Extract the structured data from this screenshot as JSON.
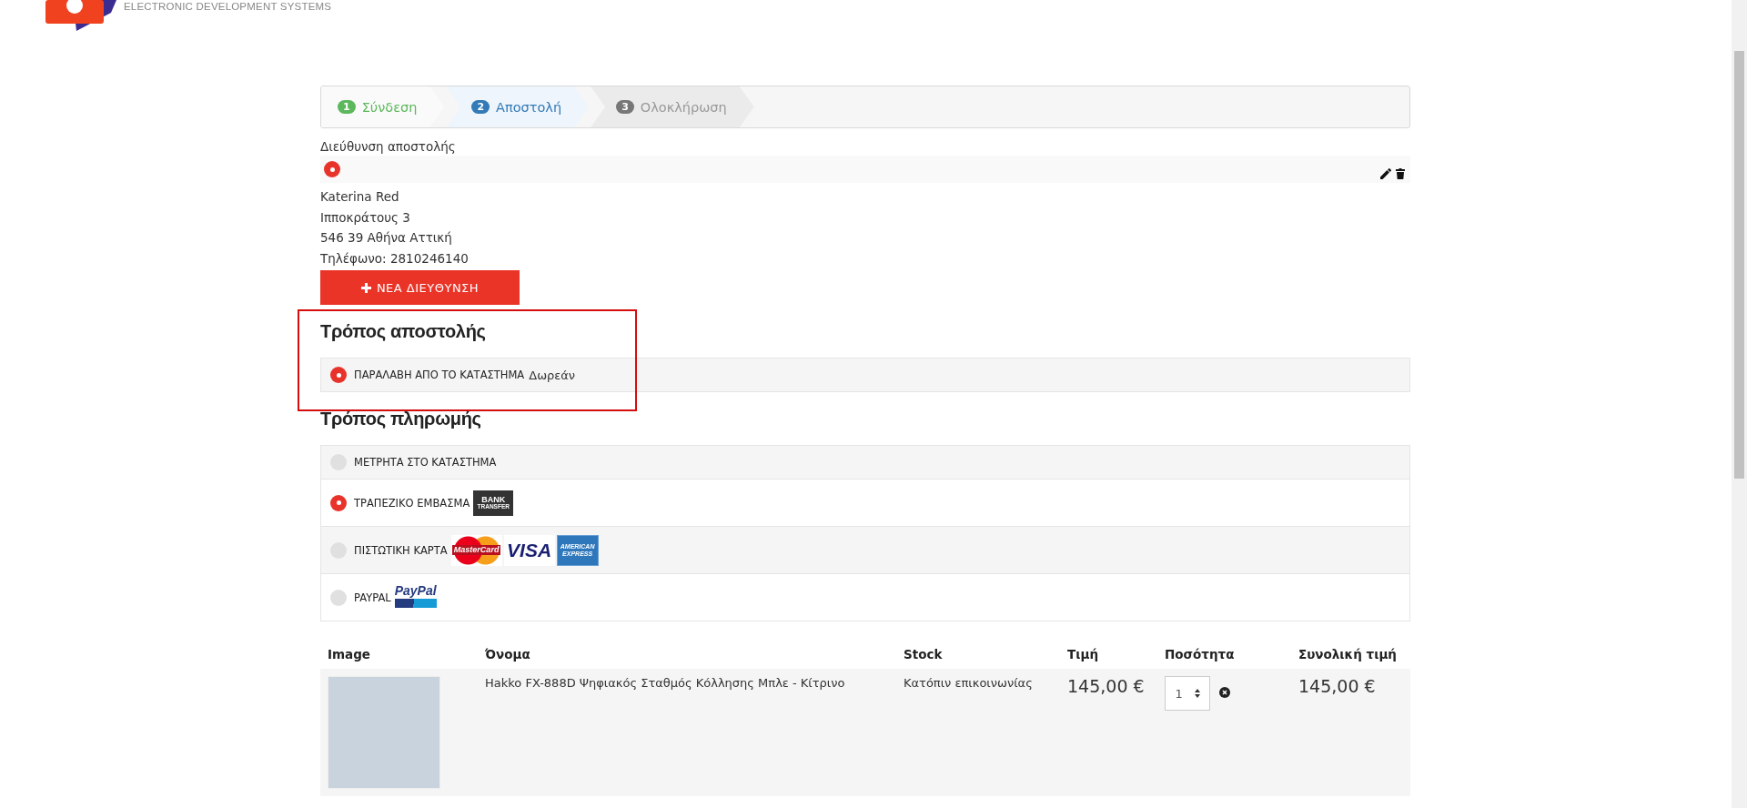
{
  "logo": {
    "tagline": "ELECTRONIC DEVELOPMENT SYSTEMS"
  },
  "steps": [
    {
      "number": "1",
      "label": "Σύνδεση",
      "completed": true,
      "selected": false
    },
    {
      "number": "2",
      "label": "Αποστολή",
      "completed": false,
      "selected": true
    },
    {
      "number": "3",
      "label": "Ολοκλήρωση",
      "completed": false,
      "selected": false
    }
  ],
  "address": {
    "title": "Διεύθυνση αποστολής",
    "selected": true,
    "lines": [
      "Katerina Red",
      "Ιπποκράτους 3",
      "546 39 Αθήνα Αττική",
      "Τηλέφωνο: 2810246140"
    ],
    "new_button": "ΝΕΑ ΔΙΕΥΘΥΝΣΗ"
  },
  "shipping": {
    "title": "Τρόπος αποστολής",
    "highlighted": true,
    "options": [
      {
        "label": "ΠΑΡΑΛΑΒΗ ΑΠΟ ΤΟ ΚΑΤΑΣΤΗΜΑ",
        "price": "Δωρεάν",
        "selected": true
      }
    ]
  },
  "payment": {
    "title": "Τρόπος πληρωμής",
    "options": [
      {
        "label": "ΜΕΤΡΗΤΑ ΣΤΟ ΚΑΤΑΣΤΗΜΑ",
        "selected": false
      },
      {
        "label": "ΤΡΑΠΕΖΙΚΟ ΕΜΒΑΣΜΑ",
        "selected": true,
        "logos": [
          {
            "kind": "bank",
            "lines": [
              "BANK",
              "TRANSFER"
            ]
          }
        ]
      },
      {
        "label": "ΠΙΣΤΩΤΙΚΗ ΚΑΡΤΑ",
        "selected": false,
        "logos": [
          {
            "kind": "mastercard",
            "lines": [
              "MasterCard"
            ]
          },
          {
            "kind": "visa",
            "lines": [
              "VISA"
            ]
          },
          {
            "kind": "amex",
            "lines": [
              "AMERICAN",
              "EXPRESS"
            ]
          }
        ]
      },
      {
        "label": "PAYPAL",
        "selected": false,
        "logos": [
          {
            "kind": "paypal",
            "lines": [
              "PayPal"
            ]
          }
        ]
      }
    ]
  },
  "table": {
    "columns": [
      "Image",
      "Όνομα",
      "Stock",
      "Τιμή",
      "Ποσότητα",
      "Συνολική τιμή"
    ],
    "rows": [
      {
        "name": "Hakko FX-888D Ψηφιακός Σταθμός Κόλλησης Μπλε - Κίτρινο",
        "stock": "Κατόπιν επικοινωνίας",
        "price": "145,00 €",
        "quantity": "1",
        "total": "145,00 €"
      }
    ]
  }
}
